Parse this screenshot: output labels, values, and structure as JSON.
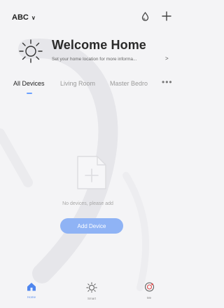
{
  "header": {
    "home_name": "ABC",
    "icons": [
      "drop-icon",
      "plus-icon"
    ]
  },
  "banner": {
    "title": "Welcome Home",
    "subtitle": "Set your home location for more informa...",
    "icon": "sun-icon"
  },
  "tabs": {
    "items": [
      {
        "label": "All Devices",
        "active": true
      },
      {
        "label": "Living Room",
        "active": false
      },
      {
        "label": "Master Bedro",
        "active": false
      }
    ],
    "more_icon": "more-icon",
    "more_label": "•••"
  },
  "empty_state": {
    "message": "No devices, please add",
    "button_label": "Add Device",
    "icon": "empty-document-icon"
  },
  "bottom_nav": {
    "items": [
      {
        "label": "Home",
        "icon": "home-icon",
        "active": true
      },
      {
        "label": "Smart",
        "icon": "smart-icon",
        "active": false
      },
      {
        "label": "Me",
        "icon": "me-icon",
        "active": false
      }
    ]
  },
  "colors": {
    "accent": "#5b8ff0",
    "button": "#8fb3f5",
    "background": "#f4f4f6"
  }
}
